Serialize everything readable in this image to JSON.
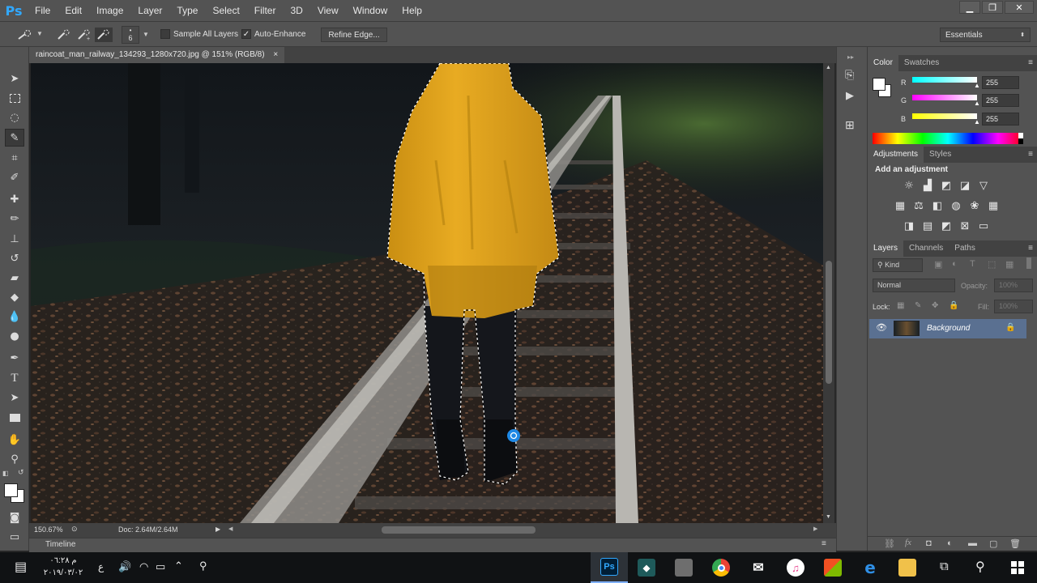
{
  "app": {
    "logo": "Ps"
  },
  "menu": [
    "File",
    "Edit",
    "Image",
    "Layer",
    "Type",
    "Select",
    "Filter",
    "3D",
    "View",
    "Window",
    "Help"
  ],
  "window_controls": {
    "minimize": "▁",
    "restore": "❐",
    "close": "✕"
  },
  "options": {
    "brush_size": "6",
    "sample_all_layers": "Sample All Layers",
    "sample_all_layers_checked": false,
    "auto_enhance": "Auto-Enhance",
    "auto_enhance_checked": true,
    "refine_edge": "Refine Edge...",
    "workspace": "Essentials"
  },
  "document": {
    "tab_title": "raincoat_man_railway_134293_1280x720.jpg @ 151% (RGB/8)",
    "tab_close": "×",
    "zoom": "150.67%",
    "doc_size": "Doc: 2.64M/2.64M"
  },
  "timeline_label": "Timeline",
  "color_panel": {
    "tabs": [
      "Color",
      "Swatches"
    ],
    "channels": [
      {
        "label": "R",
        "value": "255",
        "color": "#00e5ff"
      },
      {
        "label": "G",
        "value": "255",
        "color": "#ff40ff"
      },
      {
        "label": "B",
        "value": "255",
        "color": "#ffff00"
      }
    ]
  },
  "adjustments_panel": {
    "tabs": [
      "Adjustments",
      "Styles"
    ],
    "heading": "Add an adjustment"
  },
  "layers_panel": {
    "tabs": [
      "Layers",
      "Channels",
      "Paths"
    ],
    "filter_kind": "Kind",
    "blend_mode": "Normal",
    "opacity_label": "Opacity:",
    "opacity_value": "100%",
    "lock_label": "Lock:",
    "fill_label": "Fill:",
    "fill_value": "100%",
    "layers": [
      {
        "name": "Background",
        "visible": true,
        "locked": true
      }
    ]
  },
  "taskbar": {
    "clock_time": "م ٠٦:٢٨",
    "clock_date": "٢٠١٩/٠٣/٠٢",
    "lang": "ع",
    "apps": [
      "Ps"
    ]
  },
  "colors": {
    "ui_panel": "#535353",
    "ui_dark": "#424242",
    "raincoat": "#e2a41c",
    "selection_accent": "#1e88e5"
  }
}
